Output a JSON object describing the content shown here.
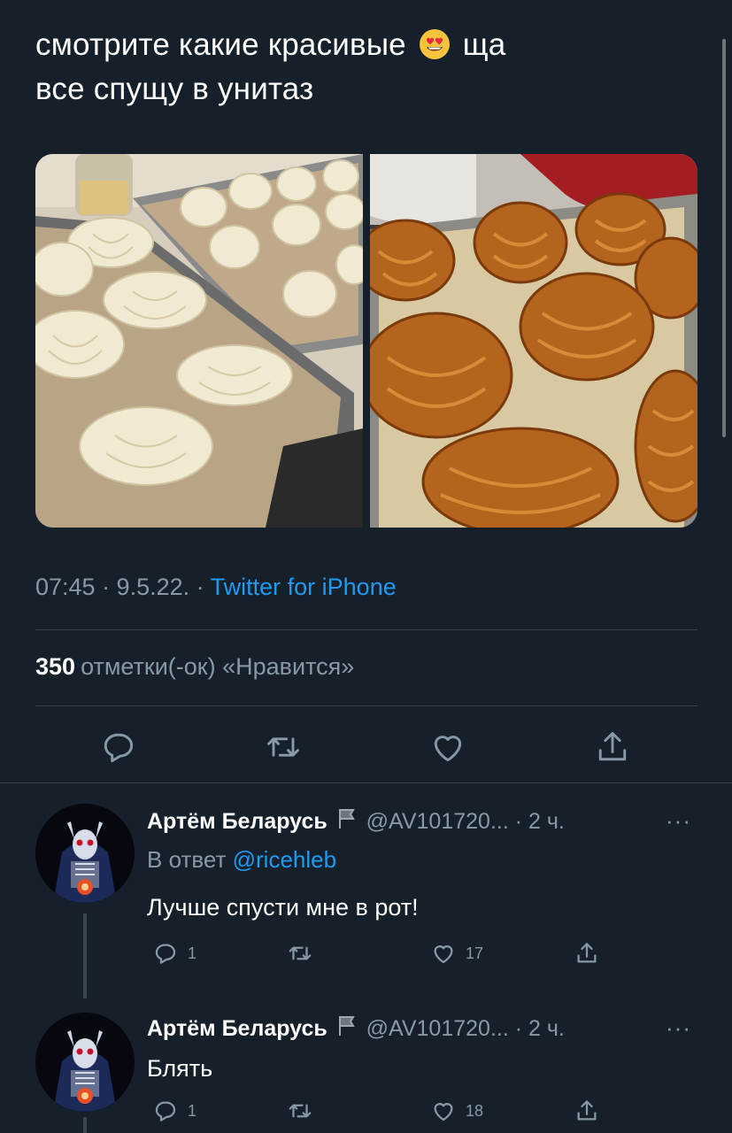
{
  "tweet": {
    "text_line1": "смотрите какие красивые",
    "text_after_emoji": "ща",
    "text_line2": "все спущу в унитаз",
    "emoji": "heart-eyes-emoji",
    "time": "07:45 · 9.5.22. · ",
    "source": "Twitter for iPhone",
    "likes_count": "350",
    "likes_label": "отметки(-ок) «Нравится»"
  },
  "actions": [
    "reply-icon",
    "retweet-icon",
    "like-icon",
    "share-icon"
  ],
  "replies": [
    {
      "name": "Артём Беларусь",
      "handle": "@AV101720...",
      "time": " · 2 ч.",
      "reply_prefix": "В ответ",
      "reply_to": "@ricehleb",
      "text": "Лучше спусти мне в рот!",
      "reply_count": "1",
      "retweet_count": "",
      "like_count": "17"
    },
    {
      "name": "Артём Беларусь",
      "handle": "@AV101720...",
      "time": " · 2 ч.",
      "text": "Блять",
      "reply_count": "1",
      "retweet_count": "",
      "like_count": "18"
    }
  ],
  "more_label": "···",
  "colors": {
    "background": "#15202b",
    "muted": "#8899a6",
    "accent": "#1d9bf0",
    "divider": "#38444d"
  }
}
